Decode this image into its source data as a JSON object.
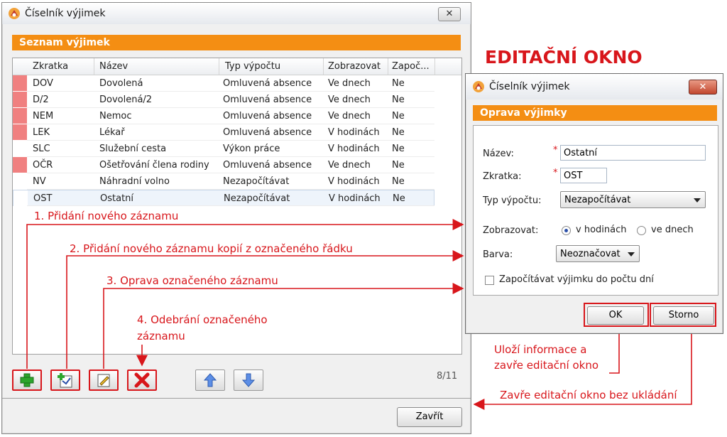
{
  "main_window": {
    "title": "Číselník výjimek",
    "close_label": "✕",
    "section_header": "Seznam výjimek",
    "columns": [
      "Zkratka",
      "Název",
      "Typ výpočtu",
      "Zobrazovat",
      "Započ..."
    ],
    "rows": [
      {
        "code": "DOV",
        "name": "Dovolená",
        "type": "Omluvená absence",
        "display": "Ve dnech",
        "count": "Ne",
        "color": "#f08080"
      },
      {
        "code": "D/2",
        "name": "Dovolená/2",
        "type": "Omluvená absence",
        "display": "Ve dnech",
        "count": "Ne",
        "color": "#f08080"
      },
      {
        "code": "NEM",
        "name": "Nemoc",
        "type": "Omluvená absence",
        "display": "Ve dnech",
        "count": "Ne",
        "color": "#f08080"
      },
      {
        "code": "LEK",
        "name": "Lékař",
        "type": "Omluvená absence",
        "display": "V hodinách",
        "count": "Ne",
        "color": "#f08080"
      },
      {
        "code": "SLC",
        "name": "Služební cesta",
        "type": "Výkon práce",
        "display": "V hodinách",
        "count": "Ne",
        "color": "#ffffff"
      },
      {
        "code": "OČR",
        "name": "Ošetřování člena rodiny",
        "type": "Omluvená absence",
        "display": "Ve dnech",
        "count": "Ne",
        "color": "#f08080"
      },
      {
        "code": "NV",
        "name": "Náhradní volno",
        "type": "Nezapočítávat",
        "display": "V hodinách",
        "count": "Ne",
        "color": "#ffffff"
      },
      {
        "code": "OST",
        "name": "Ostatní",
        "type": "Nezapočítávat",
        "display": "V hodinách",
        "count": "Ne",
        "color": "#ffffff"
      }
    ],
    "page_count": "8/11",
    "close_button": "Zavřít",
    "toolbar_icons": [
      "add-icon",
      "copy-add-icon",
      "edit-icon",
      "delete-icon",
      "move-up-icon",
      "move-down-icon"
    ]
  },
  "annotations": {
    "heading": "EDITAČNÍ OKNO",
    "a1": "1. Přidání nového záznamu",
    "a2": "2. Přidání nového záznamu kopií z označeného řádku",
    "a3": "3. Oprava označeného záznamu",
    "a4_line1": "4. Odebrání označeného",
    "a4_line2": "záznamu",
    "ok_line1": "Uloží informace a",
    "ok_line2": "zavře editační okno",
    "storno_note": "Zavře editační okno bez ukládání"
  },
  "edit_window": {
    "title": "Číselník výjimek",
    "close_label": "✕",
    "section_header": "Oprava výjimky",
    "name_label": "Název:",
    "name_value": "Ostatní",
    "code_label": "Zkratka:",
    "code_value": "OST",
    "required_mark": "*",
    "type_label": "Typ výpočtu:",
    "type_value": "Nezapočítávat",
    "display_label": "Zobrazovat:",
    "radio_hours": "v hodinách",
    "radio_days": "ve dnech",
    "color_label": "Barva:",
    "color_value": "Neoznačovat",
    "checkbox_label": "Započítávat výjimku do počtu dní",
    "ok_button": "OK",
    "cancel_button": "Storno"
  },
  "colors": {
    "accent": "#f48e13",
    "annotation": "#d8161b"
  }
}
